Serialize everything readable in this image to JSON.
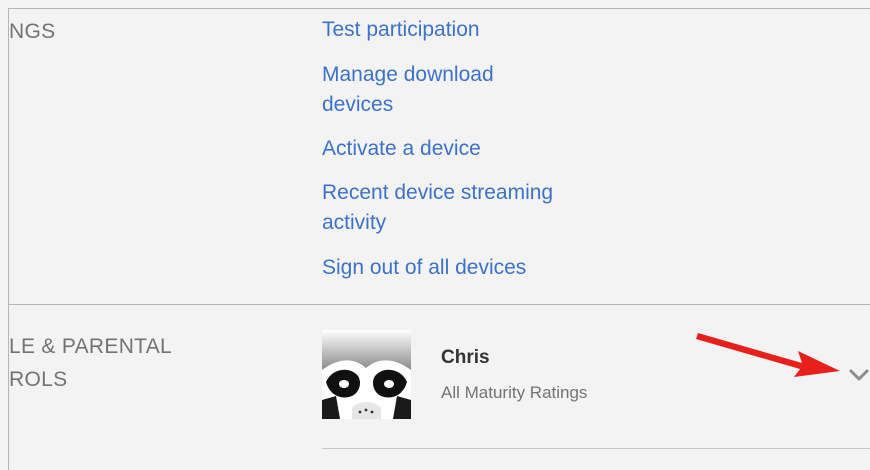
{
  "settings": {
    "section_label": "NGS",
    "links": [
      {
        "label_line1": "Test participation"
      },
      {
        "label_line1": "Manage download",
        "label_line2": "devices"
      },
      {
        "label_line1": "Activate a device"
      },
      {
        "label_line1": "Recent device streaming",
        "label_line2": "activity"
      },
      {
        "label_line1": "Sign out of all devices"
      }
    ]
  },
  "profile_section": {
    "label_line1": "LE & PARENTAL",
    "label_line2": "ROLS",
    "profile": {
      "name": "Chris",
      "subtitle": "All Maturity Ratings",
      "avatar_icon": "panda-avatar-icon"
    },
    "expand_icon": "chevron-down-icon"
  },
  "colors": {
    "link": "#3d72c9",
    "background": "#f3f3f3",
    "annotation_arrow": "#e8201c"
  }
}
